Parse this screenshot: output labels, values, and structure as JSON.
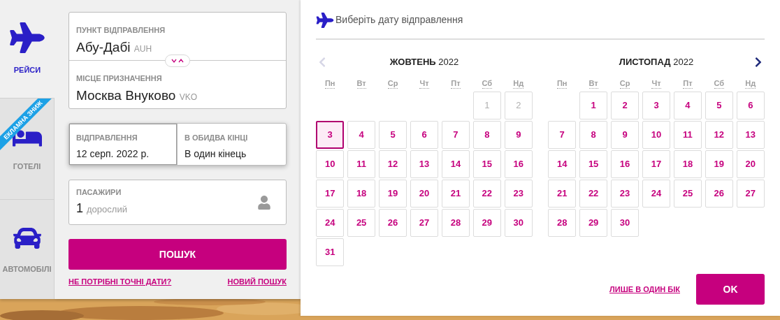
{
  "sidebar": {
    "tabs": [
      {
        "kind": "flights",
        "label": "РЕЙСИ",
        "selected": true
      },
      {
        "kind": "hotels",
        "label": "ГОТЕЛІ",
        "selected": false,
        "ribbon": "ЕКЛАМНА ЗНИЖ"
      },
      {
        "kind": "cars",
        "label": "АВТОМОБІЛІ",
        "selected": false
      }
    ]
  },
  "search_form": {
    "origin": {
      "label": "ПУНКТ ВІДПРАВЛЕННЯ",
      "city": "Абу-Дабі",
      "code": "AUH"
    },
    "destination": {
      "label": "МІСЦЕ ПРИЗНАЧЕННЯ",
      "city": "Москва Внуково",
      "code": "VKO"
    },
    "departure": {
      "label": "ВІДПРАВЛЕННЯ",
      "value": "12 серп. 2022 р.",
      "selected": true
    },
    "trip_type": {
      "label": "В ОБИДВА КІНЦІ",
      "value": "В один кінець",
      "selected": false
    },
    "passengers": {
      "label": "ПАСАЖИРИ",
      "count": "1",
      "unit": "дорослий"
    },
    "search_button": "ПОШУК",
    "links": [
      "НЕ ПОТРІБНІ ТОЧНІ ДАТИ?",
      "НОВИЙ ПОШУК"
    ]
  },
  "calendar": {
    "title": "Виберіть дату відправлення",
    "prev": {
      "disabled": true
    },
    "next": {
      "disabled": false
    },
    "months": [
      {
        "name": "ЖОВТЕНЬ",
        "year": "2022",
        "weekdays": [
          "Пн",
          "Вт",
          "Ср",
          "Чт",
          "Пт",
          "Сб",
          "Нд"
        ],
        "days": [
          {
            "kind": "empty"
          },
          {
            "kind": "empty"
          },
          {
            "kind": "empty"
          },
          {
            "kind": "empty"
          },
          {
            "kind": "empty"
          },
          {
            "kind": "day",
            "day": "1",
            "disabled": true,
            "selected": false
          },
          {
            "kind": "day",
            "day": "2",
            "disabled": true,
            "selected": false
          },
          {
            "kind": "day",
            "day": "3",
            "disabled": false,
            "selected": true
          },
          {
            "kind": "day",
            "day": "4",
            "disabled": false,
            "selected": false
          },
          {
            "kind": "day",
            "day": "5",
            "disabled": false,
            "selected": false
          },
          {
            "kind": "day",
            "day": "6",
            "disabled": false,
            "selected": false
          },
          {
            "kind": "day",
            "day": "7",
            "disabled": false,
            "selected": false
          },
          {
            "kind": "day",
            "day": "8",
            "disabled": false,
            "selected": false
          },
          {
            "kind": "day",
            "day": "9",
            "disabled": false,
            "selected": false
          },
          {
            "kind": "day",
            "day": "10",
            "disabled": false,
            "selected": false
          },
          {
            "kind": "day",
            "day": "11",
            "disabled": false,
            "selected": false
          },
          {
            "kind": "day",
            "day": "12",
            "disabled": false,
            "selected": false
          },
          {
            "kind": "day",
            "day": "13",
            "disabled": false,
            "selected": false
          },
          {
            "kind": "day",
            "day": "14",
            "disabled": false,
            "selected": false
          },
          {
            "kind": "day",
            "day": "15",
            "disabled": false,
            "selected": false
          },
          {
            "kind": "day",
            "day": "16",
            "disabled": false,
            "selected": false
          },
          {
            "kind": "day",
            "day": "17",
            "disabled": false,
            "selected": false
          },
          {
            "kind": "day",
            "day": "18",
            "disabled": false,
            "selected": false
          },
          {
            "kind": "day",
            "day": "19",
            "disabled": false,
            "selected": false
          },
          {
            "kind": "day",
            "day": "20",
            "disabled": false,
            "selected": false
          },
          {
            "kind": "day",
            "day": "21",
            "disabled": false,
            "selected": false
          },
          {
            "kind": "day",
            "day": "22",
            "disabled": false,
            "selected": false
          },
          {
            "kind": "day",
            "day": "23",
            "disabled": false,
            "selected": false
          },
          {
            "kind": "day",
            "day": "24",
            "disabled": false,
            "selected": false
          },
          {
            "kind": "day",
            "day": "25",
            "disabled": false,
            "selected": false
          },
          {
            "kind": "day",
            "day": "26",
            "disabled": false,
            "selected": false
          },
          {
            "kind": "day",
            "day": "27",
            "disabled": false,
            "selected": false
          },
          {
            "kind": "day",
            "day": "28",
            "disabled": false,
            "selected": false
          },
          {
            "kind": "day",
            "day": "29",
            "disabled": false,
            "selected": false
          },
          {
            "kind": "day",
            "day": "30",
            "disabled": false,
            "selected": false
          },
          {
            "kind": "day",
            "day": "31",
            "disabled": false,
            "selected": false
          }
        ]
      },
      {
        "name": "ЛИСТОПАД",
        "year": "2022",
        "weekdays": [
          "Пн",
          "Вт",
          "Ср",
          "Чт",
          "Пт",
          "Сб",
          "Нд"
        ],
        "days": [
          {
            "kind": "empty"
          },
          {
            "kind": "day",
            "day": "1",
            "disabled": false,
            "selected": false
          },
          {
            "kind": "day",
            "day": "2",
            "disabled": false,
            "selected": false
          },
          {
            "kind": "day",
            "day": "3",
            "disabled": false,
            "selected": false
          },
          {
            "kind": "day",
            "day": "4",
            "disabled": false,
            "selected": false
          },
          {
            "kind": "day",
            "day": "5",
            "disabled": false,
            "selected": false
          },
          {
            "kind": "day",
            "day": "6",
            "disabled": false,
            "selected": false
          },
          {
            "kind": "day",
            "day": "7",
            "disabled": false,
            "selected": false
          },
          {
            "kind": "day",
            "day": "8",
            "disabled": false,
            "selected": false
          },
          {
            "kind": "day",
            "day": "9",
            "disabled": false,
            "selected": false
          },
          {
            "kind": "day",
            "day": "10",
            "disabled": false,
            "selected": false
          },
          {
            "kind": "day",
            "day": "11",
            "disabled": false,
            "selected": false
          },
          {
            "kind": "day",
            "day": "12",
            "disabled": false,
            "selected": false
          },
          {
            "kind": "day",
            "day": "13",
            "disabled": false,
            "selected": false
          },
          {
            "kind": "day",
            "day": "14",
            "disabled": false,
            "selected": false
          },
          {
            "kind": "day",
            "day": "15",
            "disabled": false,
            "selected": false
          },
          {
            "kind": "day",
            "day": "16",
            "disabled": false,
            "selected": false
          },
          {
            "kind": "day",
            "day": "17",
            "disabled": false,
            "selected": false
          },
          {
            "kind": "day",
            "day": "18",
            "disabled": false,
            "selected": false
          },
          {
            "kind": "day",
            "day": "19",
            "disabled": false,
            "selected": false
          },
          {
            "kind": "day",
            "day": "20",
            "disabled": false,
            "selected": false
          },
          {
            "kind": "day",
            "day": "21",
            "disabled": false,
            "selected": false
          },
          {
            "kind": "day",
            "day": "22",
            "disabled": false,
            "selected": false
          },
          {
            "kind": "day",
            "day": "23",
            "disabled": false,
            "selected": false
          },
          {
            "kind": "day",
            "day": "24",
            "disabled": false,
            "selected": false
          },
          {
            "kind": "day",
            "day": "25",
            "disabled": false,
            "selected": false
          },
          {
            "kind": "day",
            "day": "26",
            "disabled": false,
            "selected": false
          },
          {
            "kind": "day",
            "day": "27",
            "disabled": false,
            "selected": false
          },
          {
            "kind": "day",
            "day": "28",
            "disabled": false,
            "selected": false
          },
          {
            "kind": "day",
            "day": "29",
            "disabled": false,
            "selected": false
          },
          {
            "kind": "day",
            "day": "30",
            "disabled": false,
            "selected": false
          }
        ]
      }
    ],
    "one_way_link": "ЛИШЕ В ОДИН БІК",
    "ok_button": "OK"
  }
}
